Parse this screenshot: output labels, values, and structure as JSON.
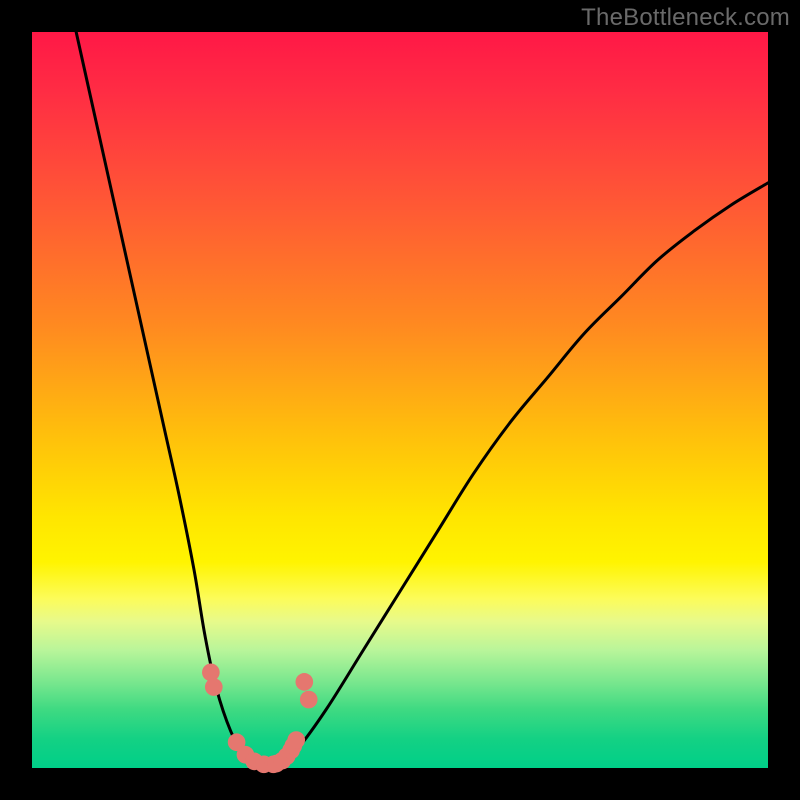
{
  "watermark": "TheBottleneck.com",
  "chart_data": {
    "type": "line",
    "title": "",
    "xlabel": "",
    "ylabel": "",
    "xlim": [
      0,
      100
    ],
    "ylim": [
      0,
      100
    ],
    "series": [
      {
        "name": "bottleneck-curve",
        "x": [
          6,
          8,
          10,
          12,
          14,
          16,
          18,
          20,
          22,
          23.5,
          25,
          27,
          29,
          31,
          32.5,
          34,
          36,
          40,
          45,
          50,
          55,
          60,
          65,
          70,
          75,
          80,
          85,
          90,
          95,
          100
        ],
        "values": [
          100,
          91,
          82,
          73,
          64,
          55,
          46,
          37,
          27,
          18,
          11,
          5,
          1.5,
          0.6,
          0.4,
          0.8,
          2.5,
          8,
          16,
          24,
          32,
          40,
          47,
          53,
          59,
          64,
          69,
          73,
          76.5,
          79.5
        ]
      }
    ],
    "markers": [
      {
        "x": 24.3,
        "y": 13.0
      },
      {
        "x": 24.7,
        "y": 11.0
      },
      {
        "x": 27.8,
        "y": 3.5
      },
      {
        "x": 29.0,
        "y": 1.8
      },
      {
        "x": 30.2,
        "y": 0.9
      },
      {
        "x": 31.5,
        "y": 0.5
      },
      {
        "x": 32.8,
        "y": 0.5
      },
      {
        "x": 33.2,
        "y": 0.6
      },
      {
        "x": 34.0,
        "y": 1.0
      },
      {
        "x": 34.6,
        "y": 1.6
      },
      {
        "x": 35.2,
        "y": 2.4
      },
      {
        "x": 35.5,
        "y": 3.0
      },
      {
        "x": 35.9,
        "y": 3.8
      },
      {
        "x": 37.6,
        "y": 9.3
      },
      {
        "x": 37.0,
        "y": 11.7
      }
    ],
    "marker_style": {
      "color": "#e5776f",
      "radius_pct": 1.2
    }
  }
}
